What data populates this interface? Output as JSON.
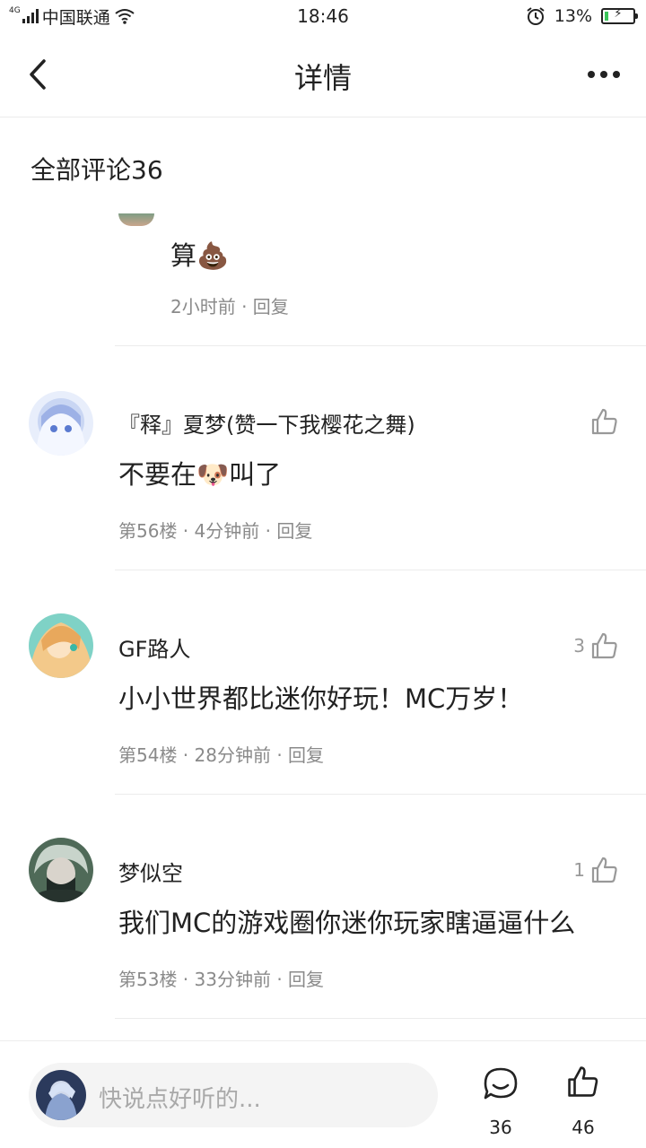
{
  "status_bar": {
    "network_type": "4G",
    "carrier": "中国联通",
    "time": "18:46",
    "battery_percent": "13%",
    "battery_level": 0.13,
    "icons": [
      "signal-icon",
      "wifi-icon",
      "alarm-icon",
      "battery-icon"
    ]
  },
  "header": {
    "title": "详情",
    "back_icon": "chevron-left-icon",
    "more_icon": "more-dots-icon"
  },
  "comments_header": "全部评论36",
  "partial_comment": {
    "text": "算💩",
    "meta": "2小时前 · 回复"
  },
  "comments": [
    {
      "name": "『释』夏梦(赞一下我樱花之舞)",
      "text": "不要在🐶叫了",
      "meta": "第56楼 · 4分钟前 · 回复",
      "likes": "",
      "avatar_colors": [
        "#dfe6f7",
        "#7a93d6"
      ]
    },
    {
      "name": "GF路人",
      "text": "小小世界都比迷你好玩！MC万岁！",
      "meta": "第54楼 · 28分钟前 · 回复",
      "likes": "3",
      "avatar_colors": [
        "#f2c98a",
        "#6fcfc3"
      ]
    },
    {
      "name": "梦似空",
      "text": "我们MC的游戏圈你迷你玩家瞎逼逼什么",
      "meta": "第53楼 · 33分钟前 · 回复",
      "likes": "1",
      "avatar_colors": [
        "#b9c7bd",
        "#2f4a3a"
      ]
    }
  ],
  "bottom_bar": {
    "input_placeholder": "快说点好听的...",
    "comment_count": "36",
    "like_count": "46"
  },
  "colors": {
    "text": "#222222",
    "meta": "#8a8a8a",
    "divider": "#ececec",
    "battery_green": "#3bc45a",
    "input_bg": "#f4f4f4"
  }
}
